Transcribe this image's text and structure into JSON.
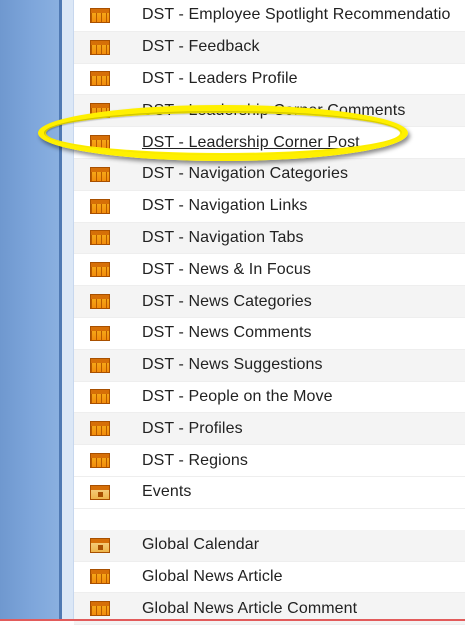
{
  "items": [
    {
      "label": "DST - Employee Spotlight Recommendatio",
      "icon": "list-icon"
    },
    {
      "label": "DST - Feedback",
      "icon": "list-icon"
    },
    {
      "label": "DST - Leaders Profile",
      "icon": "list-icon"
    },
    {
      "label": "DST - Leadership Corner Comments",
      "icon": "list-icon"
    },
    {
      "label": "DST - Leadership Corner Post",
      "icon": "list-icon"
    },
    {
      "label": "DST - Navigation Categories",
      "icon": "list-icon"
    },
    {
      "label": "DST - Navigation Links",
      "icon": "list-icon"
    },
    {
      "label": "DST - Navigation Tabs",
      "icon": "list-icon"
    },
    {
      "label": "DST - News & In Focus",
      "icon": "list-icon"
    },
    {
      "label": "DST - News Categories",
      "icon": "list-icon"
    },
    {
      "label": "DST - News Comments",
      "icon": "list-icon"
    },
    {
      "label": "DST - News Suggestions",
      "icon": "list-icon"
    },
    {
      "label": "DST - People on the Move",
      "icon": "list-icon"
    },
    {
      "label": "DST - Profiles",
      "icon": "list-icon"
    },
    {
      "label": "DST - Regions",
      "icon": "list-icon"
    },
    {
      "label": "Events",
      "icon": "calendar-icon"
    },
    {
      "label": "Global Calendar",
      "icon": "calendar-icon"
    },
    {
      "label": "Global News Article",
      "icon": "list-icon"
    },
    {
      "label": "Global News Article Comment",
      "icon": "list-icon"
    }
  ],
  "highlighted_item": "DST - Leadership Corner Post",
  "colors": {
    "highlight": "#fff000",
    "nav": "#7ea6db",
    "icon": "#f28b0c"
  }
}
